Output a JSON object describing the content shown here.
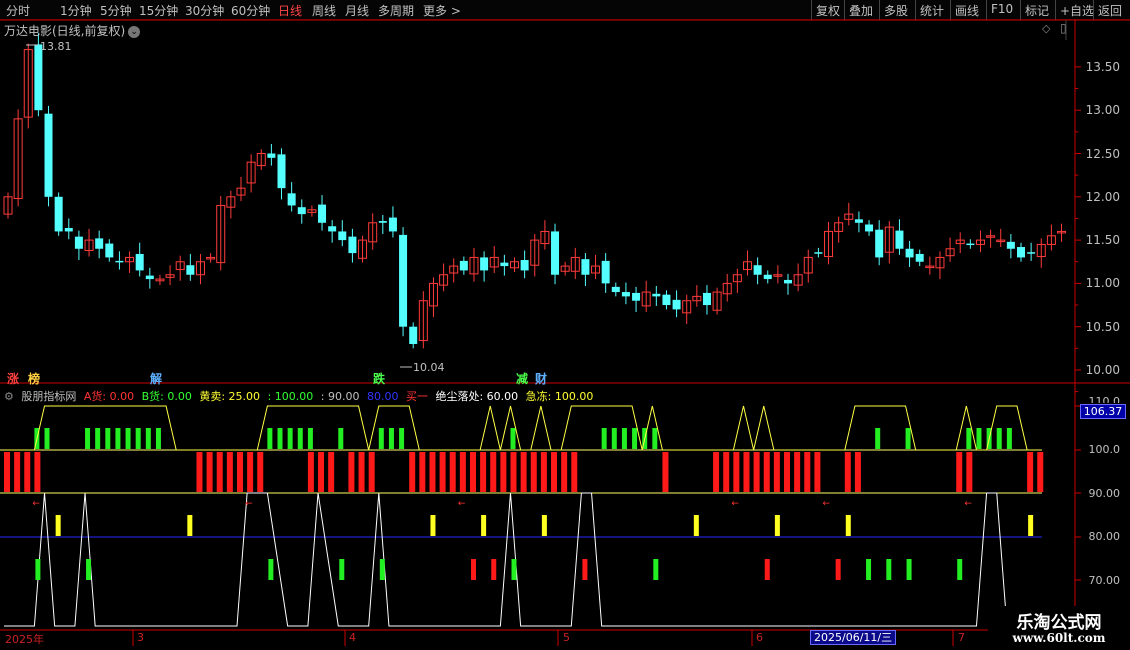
{
  "toolbar": {
    "periods": [
      "分时",
      "1分钟",
      "5分钟",
      "15分钟",
      "30分钟",
      "60分钟",
      "日线",
      "周线",
      "月线",
      "多周期",
      "更多 >"
    ],
    "active_period": "日线",
    "right_buttons": [
      "复权",
      "叠加",
      "多股",
      "统计",
      "画线",
      "F10",
      "标记",
      "+自选",
      "返回"
    ]
  },
  "chart": {
    "title": "万达电影(日线,前复权)",
    "price_axis": [
      "13.50",
      "13.00",
      "12.50",
      "12.00",
      "11.50",
      "11.00",
      "10.50",
      "10.00"
    ],
    "high_label": "13.81",
    "low_label": "10.04",
    "ylim": [
      9.95,
      13.95
    ],
    "colors": {
      "up": "#ff3b3b",
      "down": "#54ffff",
      "bg": "#000000"
    }
  },
  "badges": [
    {
      "text": "涨",
      "color": "#ff4040"
    },
    {
      "text": "榜",
      "color": "#ffd040"
    },
    {
      "text": "解",
      "color": "#5fb0ff"
    },
    {
      "text": "跌",
      "color": "#4cff4c"
    },
    {
      "text": "减",
      "color": "#4cff4c"
    },
    {
      "text": "财",
      "color": "#5fb0ff"
    }
  ],
  "indicator": {
    "name": "股朋指标网",
    "items": [
      {
        "text": "A货: 0.00",
        "color": "#ff3333"
      },
      {
        "text": "B货: 0.00",
        "color": "#33ff33"
      },
      {
        "text": "黄卖: 25.00",
        "color": "#ffff33"
      },
      {
        "text": ": 100.00",
        "color": "#33ff33"
      },
      {
        "text": ": 90.00",
        "color": "#c0c0c0"
      },
      {
        "text": "80.00",
        "color": "#3333ff"
      },
      {
        "text": "买一",
        "color": "#ff3333"
      },
      {
        "text": "绝尘落处: 60.00",
        "color": "#ffffff"
      },
      {
        "text": "急冻: 100.00",
        "color": "#ffff33"
      }
    ],
    "axis": [
      "100.0",
      "90.00",
      "80.00",
      "70.00"
    ],
    "partial_top_label": "110.0",
    "current_value": "106.37"
  },
  "x_axis": {
    "labels": [
      "2025年",
      "3",
      "4",
      "5",
      "6",
      "7"
    ],
    "selected_date": "2025/06/11/三"
  },
  "watermark": {
    "line1": "乐淘公式网",
    "line2": "www.60lt.com"
  }
}
